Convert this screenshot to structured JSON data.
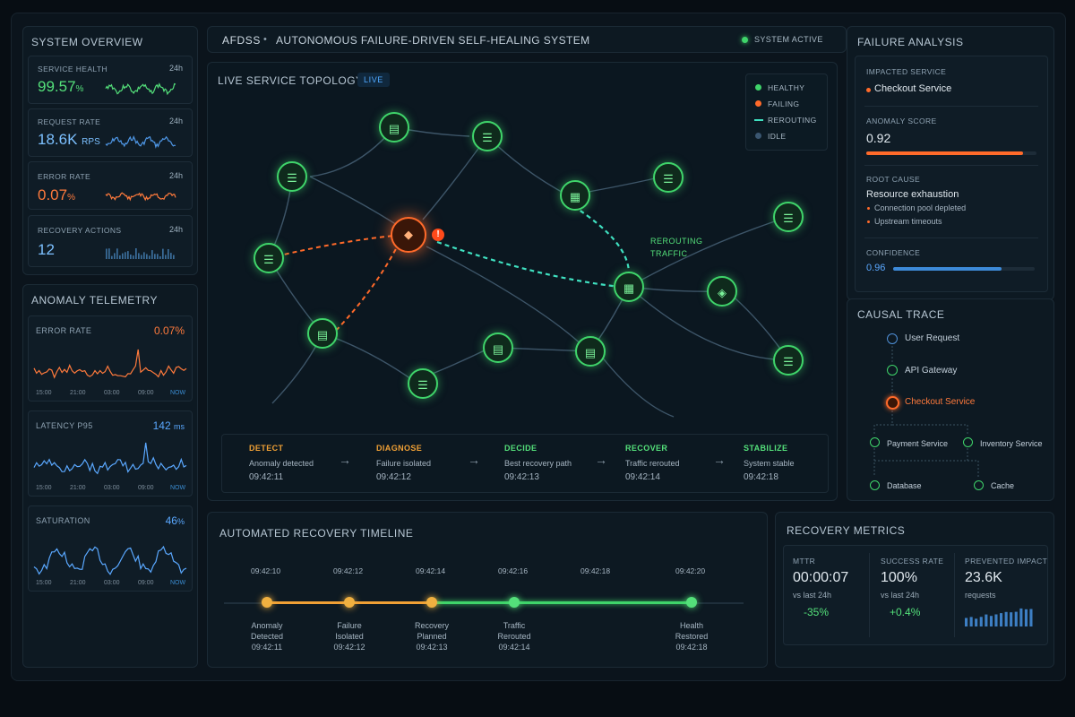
{
  "header": {
    "app_short": "AFDSS",
    "separator": "•",
    "app_full": "AUTONOMOUS FAILURE-DRIVEN SELF-HEALING SYSTEM",
    "status": "SYSTEM ACTIVE",
    "status_color": "#3fd46a"
  },
  "system_overview": {
    "title": "SYSTEM OVERVIEW",
    "cards": [
      {
        "label": "SERVICE HEALTH",
        "period": "24h",
        "value": "99.57",
        "unit": "%",
        "color": "#54e07a",
        "icon": "sparkline"
      },
      {
        "label": "REQUEST RATE",
        "period": "24h",
        "value": "18.6K",
        "unit": "RPS",
        "color": "#7cc0ff",
        "icon": "sparkline"
      },
      {
        "label": "ERROR RATE",
        "period": "24h",
        "value": "0.07",
        "unit": "%",
        "color": "#ff7a3c",
        "icon": "sparkline"
      },
      {
        "label": "RECOVERY ACTIONS",
        "period": "24h",
        "value": "12",
        "unit": "",
        "color": "#7cc0ff",
        "icon": "bar-sparkline"
      }
    ]
  },
  "anomaly_telemetry": {
    "title": "ANOMALY TELEMETRY",
    "cards": [
      {
        "label": "ERROR RATE",
        "value": "0.07",
        "unit": "%",
        "color": "#ff7a3c"
      },
      {
        "label": "LATENCY P95",
        "value": "142",
        "unit": "ms",
        "color": "#5aa8ff"
      },
      {
        "label": "SATURATION",
        "value": "46",
        "unit": "%",
        "color": "#5aa8ff"
      }
    ],
    "axis": [
      "15:00",
      "21:00",
      "03:00",
      "09:00",
      "NOW"
    ]
  },
  "topology": {
    "title": "LIVE SERVICE TOPOLOGY",
    "live_badge": "LIVE",
    "legend": [
      {
        "label": "HEALTHY",
        "color": "#3fd46a"
      },
      {
        "label": "FAILING",
        "color": "#ff6a2a"
      },
      {
        "label": "REROUTING",
        "color": "#3fe0c0"
      },
      {
        "label": "IDLE",
        "color": "#3a5670"
      }
    ],
    "reroute_label_1": "REROUTING",
    "reroute_label_2": "TRAFFIC",
    "alert_icon": "!"
  },
  "stages": [
    {
      "head": "DETECT",
      "sub": "Anomaly detected",
      "time": "09:42:11",
      "color": "#f0a035"
    },
    {
      "head": "DIAGNOSE",
      "sub": "Failure isolated",
      "time": "09:42:12",
      "color": "#f0a035"
    },
    {
      "head": "DECIDE",
      "sub": "Best recovery path",
      "time": "09:42:13",
      "color": "#54e07a"
    },
    {
      "head": "RECOVER",
      "sub": "Traffic rerouted",
      "time": "09:42:14",
      "color": "#54e07a"
    },
    {
      "head": "STABILIZE",
      "sub": "System stable",
      "time": "09:42:18",
      "color": "#54e07a"
    }
  ],
  "stage_arrow": "→",
  "timeline": {
    "title": "AUTOMATED RECOVERY TIMELINE",
    "ticks": [
      "09:42:10",
      "09:42:12",
      "09:42:14",
      "09:42:16",
      "09:42:18",
      "09:42:20"
    ],
    "events": [
      {
        "line1": "Anomaly",
        "line2": "Detected",
        "time": "09:42:11",
        "color": "#f0b040"
      },
      {
        "line1": "Failure",
        "line2": "Isolated",
        "time": "09:42:12",
        "color": "#f0b040"
      },
      {
        "line1": "Recovery",
        "line2": "Planned",
        "time": "09:42:13",
        "color": "#f0b040"
      },
      {
        "line1": "Traffic",
        "line2": "Rerouted",
        "time": "09:42:14",
        "color": "#54e07a"
      },
      {
        "line1": "Health",
        "line2": "Restored",
        "time": "09:42:18",
        "color": "#54e07a"
      }
    ]
  },
  "failure_analysis": {
    "title": "FAILURE ANALYSIS",
    "impacted_label": "IMPACTED SERVICE",
    "impacted_value": "Checkout Service",
    "anomaly_label": "ANOMALY SCORE",
    "anomaly_value": "0.92",
    "anomaly_fraction": 0.92,
    "root_label": "ROOT CAUSE",
    "root_value": "Resource exhaustion",
    "root_items": [
      "Connection pool depleted",
      "Upstream timeouts"
    ],
    "confidence_label": "CONFIDENCE",
    "confidence_value": "0.96",
    "confidence_fraction": 0.96
  },
  "causal_trace": {
    "title": "CAUSAL TRACE",
    "nodes": {
      "user_request": "User Request",
      "api_gateway": "API Gateway",
      "checkout": "Checkout Service",
      "payment": "Payment Service",
      "inventory": "Inventory Service",
      "database": "Database",
      "cache": "Cache"
    }
  },
  "recovery_metrics": {
    "title": "RECOVERY METRICS",
    "mttr_label": "MTTR",
    "mttr_value": "00:00:07",
    "mttr_sub": "vs last 24h",
    "mttr_delta": "-35%",
    "success_label": "SUCCESS RATE",
    "success_value": "100%",
    "success_sub": "vs last 24h",
    "success_delta": "+0.4%",
    "prevented_label": "PREVENTED IMPACT",
    "prevented_value": "23.6K",
    "prevented_sub": "requests"
  }
}
